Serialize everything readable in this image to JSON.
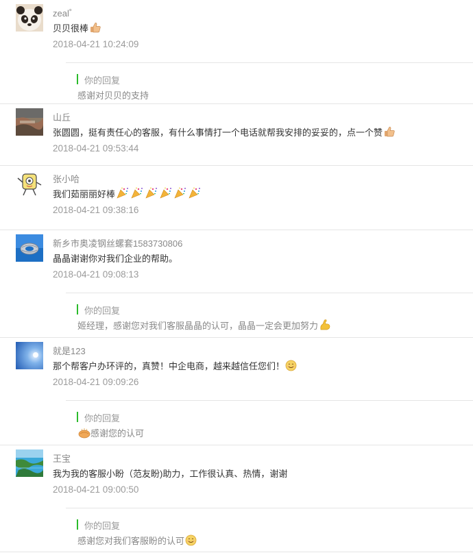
{
  "comments": [
    {
      "nickname": "zeal゜",
      "avatar": "panda-avatar",
      "text": "贝贝很棒",
      "trailing_emojis": [
        "thumbs-up-emoji"
      ],
      "time": "2018-04-21 10:24:09",
      "reply": {
        "title": "你的回复",
        "text": "感谢对贝贝的支持",
        "leading_emojis": [],
        "trailing_emojis": []
      }
    },
    {
      "nickname": "山丘",
      "avatar": "landscape-photo-avatar",
      "text": "张圆圆，挺有责任心的客服，有什么事情打一个电话就帮我安排的妥妥的，点一个赞",
      "trailing_emojis": [
        "thumbs-up-emoji"
      ],
      "time": "2018-04-21 09:53:44",
      "reply": null
    },
    {
      "nickname": "张小哈",
      "avatar": "cartoon-mascot-avatar",
      "text": "我们茹丽丽好棒",
      "trailing_emojis": [
        "party-popper-emoji",
        "party-popper-emoji",
        "party-popper-emoji",
        "party-popper-emoji",
        "party-popper-emoji",
        "party-popper-emoji"
      ],
      "time": "2018-04-21 09:38:16",
      "reply": null
    },
    {
      "nickname": "新乡市奥凌钢丝螺套1583730806",
      "avatar": "wire-coil-logo-avatar",
      "text": "晶晶谢谢你对我们企业的帮助。",
      "trailing_emojis": [],
      "time": "2018-04-21 09:08:13",
      "reply": {
        "title": "你的回复",
        "text": "姬经理，感谢您对我们客服晶晶的认可，晶晶一定会更加努力",
        "leading_emojis": [],
        "trailing_emojis": [
          "flexed-bicep-emoji"
        ]
      }
    },
    {
      "nickname": "就是123",
      "avatar": "blue-sky-avatar",
      "text": "那个帮客户办环评的，真赞！中企电商，越来越信任您们！",
      "trailing_emojis": [
        "smile-emoji"
      ],
      "time": "2018-04-21 09:09:26",
      "reply": {
        "title": "你的回复",
        "text": "感谢您的认可",
        "leading_emojis": [
          "clapping-hands-emoji"
        ],
        "trailing_emojis": []
      }
    },
    {
      "nickname": "王宝",
      "avatar": "island-photo-avatar",
      "text": "我为我的客服小盼（范友盼)助力，工作很认真、热情，谢谢",
      "trailing_emojis": [],
      "time": "2018-04-21 09:00:50",
      "reply": {
        "title": "你的回复",
        "text": "感谢您对我们客服盼的认可",
        "leading_emojis": [],
        "trailing_emojis": [
          "smile-emoji"
        ]
      }
    }
  ]
}
